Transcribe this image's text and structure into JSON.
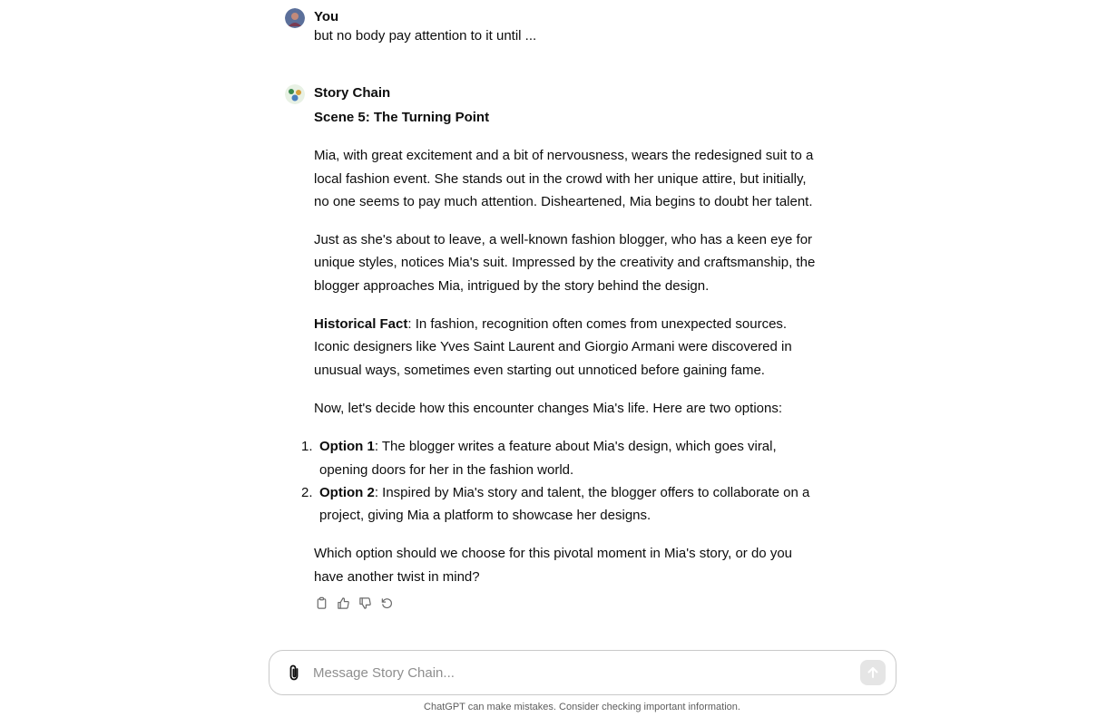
{
  "user_message": {
    "author": "You",
    "text": "but no body pay attention to it until ..."
  },
  "bot_message": {
    "author": "Story Chain",
    "scene_title": "Scene 5: The Turning Point",
    "paragraph_1": "Mia, with great excitement and a bit of nervousness, wears the redesigned suit to a local fashion event. She stands out in the crowd with her unique attire, but initially, no one seems to pay much attention. Disheartened, Mia begins to doubt her talent.",
    "paragraph_2": "Just as she's about to leave, a well-known fashion blogger, who has a keen eye for unique styles, notices Mia's suit. Impressed by the creativity and craftsmanship, the blogger approaches Mia, intrigued by the story behind the design.",
    "fact_label": "Historical Fact",
    "fact_text": ": In fashion, recognition often comes from unexpected sources. Iconic designers like Yves Saint Laurent and Giorgio Armani were discovered in unusual ways, sometimes even starting out unnoticed before gaining fame.",
    "paragraph_4": "Now, let's decide how this encounter changes Mia's life. Here are two options:",
    "options": [
      {
        "num": "1.",
        "label": "Option 1",
        "text": ": The blogger writes a feature about Mia's design, which goes viral, opening doors for her in the fashion world."
      },
      {
        "num": "2.",
        "label": "Option 2",
        "text": ": Inspired by Mia's story and talent, the blogger offers to collaborate on a project, giving Mia a platform to showcase her designs."
      }
    ],
    "closing": "Which option should we choose for this pivotal moment in Mia's story, or do you have another twist in mind?"
  },
  "actions": [
    "copy-icon",
    "thumbs-up-icon",
    "thumbs-down-icon",
    "regenerate-icon"
  ],
  "composer": {
    "placeholder": "Message Story Chain..."
  },
  "disclaimer": "ChatGPT can make mistakes. Consider checking important information.",
  "colors": {
    "text": "#0d0d0d",
    "muted": "#5d5d5d",
    "border": "#c9c9c9",
    "send_bg": "#e5e5e5"
  }
}
